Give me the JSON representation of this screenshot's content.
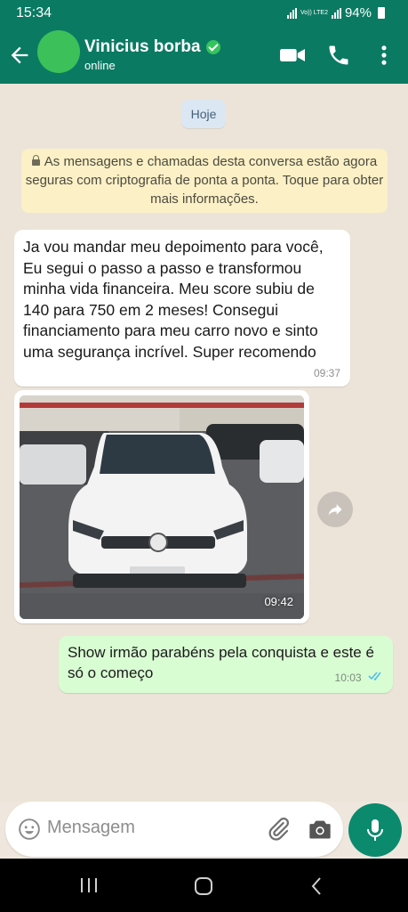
{
  "status_bar": {
    "time": "15:34",
    "network_label": "Vo)) LTE2",
    "battery": "94%"
  },
  "header": {
    "contact_name": "Vinicius borba",
    "contact_status": "online",
    "icons": [
      "back-arrow-icon",
      "verified-badge-icon",
      "video-call-icon",
      "phone-icon",
      "more-vert-icon"
    ]
  },
  "chat": {
    "day_chip": "Hoje",
    "encryption_notice": "As mensagens e chamadas desta conversa estão agora seguras com criptografia de ponta a ponta. Toque para obter mais informações.",
    "messages": [
      {
        "direction": "incoming",
        "text": "Ja vou mandar meu depoimento para você, Eu segui o passo a passo e transformou minha vida financeira. Meu score subiu de 140 para 750 em 2 meses! Consegui financiamento para meu carro novo e sinto uma segurança incrível. Super recomendo",
        "time": "09:37"
      },
      {
        "direction": "incoming",
        "type": "image",
        "time": "09:42"
      },
      {
        "direction": "outgoing",
        "text": "Show irmão parabéns pela conquista e este é só o começo",
        "time": "10:03",
        "read": true
      }
    ]
  },
  "composer": {
    "placeholder": "Mensagem",
    "icons": [
      "emoji-icon",
      "attach-icon",
      "camera-icon",
      "mic-icon"
    ]
  },
  "colors": {
    "header": "#0b7a63",
    "outgoing_bubble": "#d9fdd3",
    "incoming_bubble": "#ffffff",
    "notice": "#fbf0c6",
    "read_ticks": "#53bdeb"
  }
}
